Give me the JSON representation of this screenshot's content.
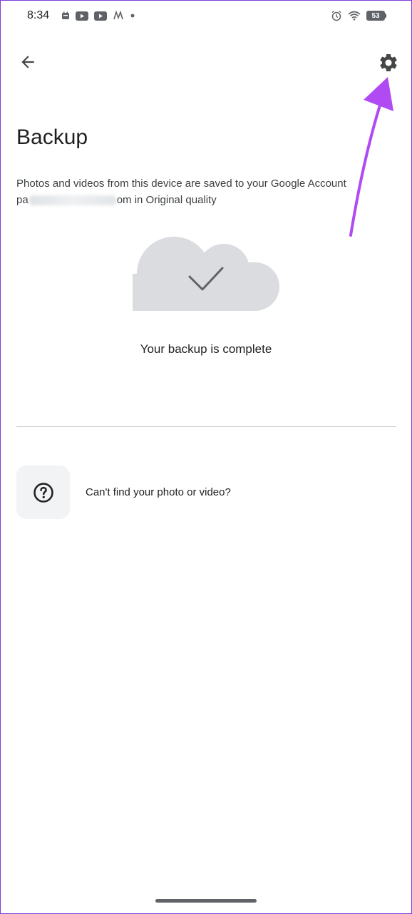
{
  "status_bar": {
    "time": "8:34",
    "battery": "53",
    "left_icons": [
      "calendar-icon",
      "youtube-icon",
      "youtube-icon",
      "app-icon",
      "dot-icon"
    ],
    "right_icons": [
      "alarm-icon",
      "wifi-icon",
      "battery-icon"
    ]
  },
  "header": {
    "back_icon": "arrow-back-icon",
    "settings_icon": "gear-icon"
  },
  "page": {
    "title": "Backup",
    "description_line1": "Photos and videos from this device are saved to your Google Account",
    "description_line2_prefix": "pa",
    "description_line2_suffix": "om in Original quality",
    "status_message": "Your backup is complete"
  },
  "help": {
    "label": "Can't find your photo or video?",
    "icon": "help-circle-icon"
  },
  "colors": {
    "cloud": "#dadce0",
    "check": "#5f6368",
    "annotation": "#b04af2",
    "help_box": "#f1f3f4",
    "divider": "#c4c7c5"
  }
}
